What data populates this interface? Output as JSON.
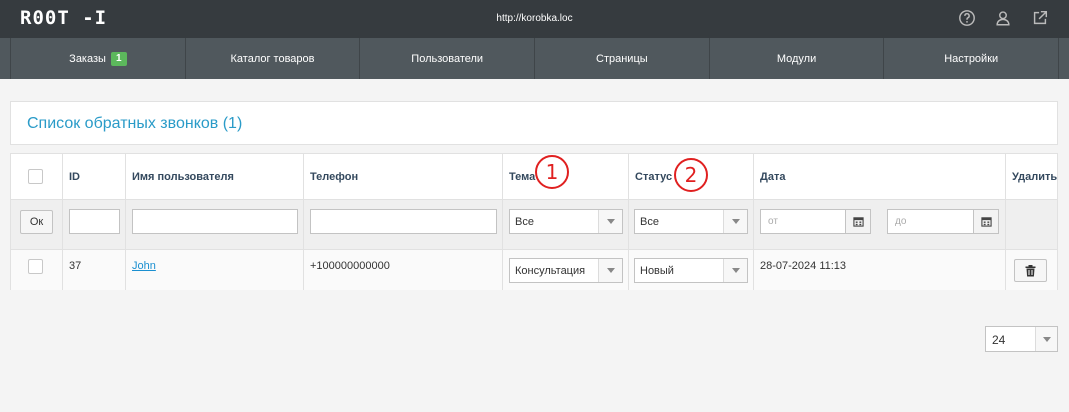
{
  "header": {
    "logo": "R00T -I",
    "site_url": "http://korobka.loc",
    "icons": [
      "help-icon",
      "user-icon",
      "external-link-icon"
    ]
  },
  "nav": {
    "items": [
      {
        "label": "Заказы",
        "badge": "1"
      },
      {
        "label": "Каталог товаров"
      },
      {
        "label": "Пользователи"
      },
      {
        "label": "Страницы"
      },
      {
        "label": "Модули"
      },
      {
        "label": "Настройки"
      }
    ]
  },
  "page": {
    "title": "Список обратных звонков (1)"
  },
  "table": {
    "columns": {
      "id": "ID",
      "user": "Имя пользователя",
      "phone": "Телефон",
      "topic": "Тема",
      "status": "Статус",
      "date": "Дата",
      "delete": "Удалить"
    },
    "filters": {
      "ok_label": "Ок",
      "id_value": "",
      "user_value": "",
      "phone_value": "",
      "topic_selected": "Все",
      "status_selected": "Все",
      "date_from_placeholder": "от",
      "date_to_placeholder": "до"
    },
    "rows": [
      {
        "id": "37",
        "user": "John",
        "phone": "+100000000000",
        "topic": "Консультация",
        "status": "Новый",
        "date": "28-07-2024 11:13"
      }
    ]
  },
  "annotations": {
    "marker_1": "1",
    "marker_2": "2",
    "color": "#e02020"
  },
  "pagination": {
    "page_size": "24"
  },
  "colors": {
    "topbar": "#363b3f",
    "nav": "#50585d",
    "accent": "#2a9bc8",
    "badge": "#5cb85c"
  }
}
